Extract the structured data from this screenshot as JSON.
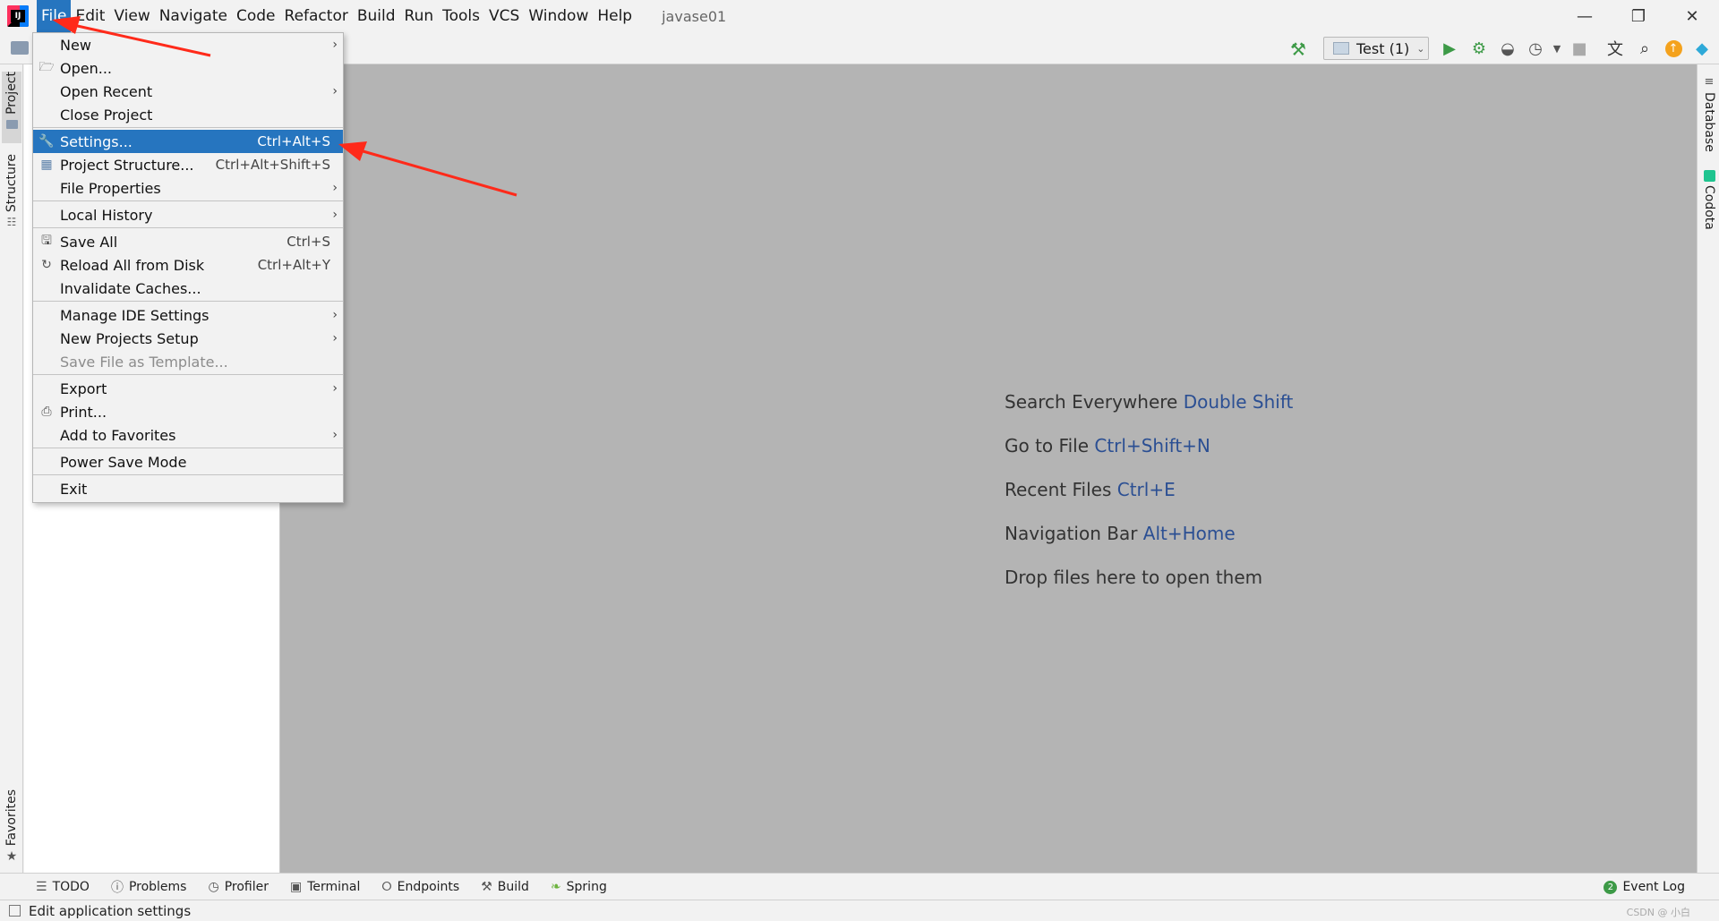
{
  "titlebar": {
    "menus": [
      "File",
      "Edit",
      "View",
      "Navigate",
      "Code",
      "Refactor",
      "Build",
      "Run",
      "Tools",
      "VCS",
      "Window",
      "Help"
    ],
    "project_name": "javase01",
    "logo_text": "IJ"
  },
  "toolbar": {
    "run_config": "Test (1)"
  },
  "left_stripe": {
    "project": "Project",
    "structure": "Structure",
    "favorites": "Favorites"
  },
  "right_stripe": {
    "database": "Database",
    "codota": "Codota"
  },
  "file_menu": {
    "new": "New",
    "open": "Open...",
    "open_recent": "Open Recent",
    "close_project": "Close Project",
    "settings": "Settings...",
    "settings_sc": "Ctrl+Alt+S",
    "project_structure": "Project Structure...",
    "project_structure_sc": "Ctrl+Alt+Shift+S",
    "file_properties": "File Properties",
    "local_history": "Local History",
    "save_all": "Save All",
    "save_all_sc": "Ctrl+S",
    "reload": "Reload All from Disk",
    "reload_sc": "Ctrl+Alt+Y",
    "invalidate": "Invalidate Caches...",
    "manage_ide": "Manage IDE Settings",
    "new_projects_setup": "New Projects Setup",
    "save_template": "Save File as Template...",
    "export": "Export",
    "print": "Print...",
    "add_favorites": "Add to Favorites",
    "power_save": "Power Save Mode",
    "exit": "Exit"
  },
  "editor_hints": {
    "search_label": "Search Everywhere ",
    "search_sc": "Double Shift",
    "goto_label": "Go to File ",
    "goto_sc": "Ctrl+Shift+N",
    "recent_label": "Recent Files ",
    "recent_sc": "Ctrl+E",
    "nav_label": "Navigation Bar ",
    "nav_sc": "Alt+Home",
    "drop": "Drop files here to open them"
  },
  "bottom_bar": {
    "todo": "TODO",
    "problems": "Problems",
    "profiler": "Profiler",
    "terminal": "Terminal",
    "endpoints": "Endpoints",
    "build": "Build",
    "spring": "Spring",
    "event_log": "Event Log",
    "event_count": "2"
  },
  "status": {
    "text": "Edit application settings",
    "watermark": "CSDN @ 小白"
  },
  "colors": {
    "menu_highlight": "#2675bf",
    "editor_bg": "#b4b4b4",
    "shortcut_text": "#2b4f93",
    "arrow": "#ff2a1a"
  }
}
